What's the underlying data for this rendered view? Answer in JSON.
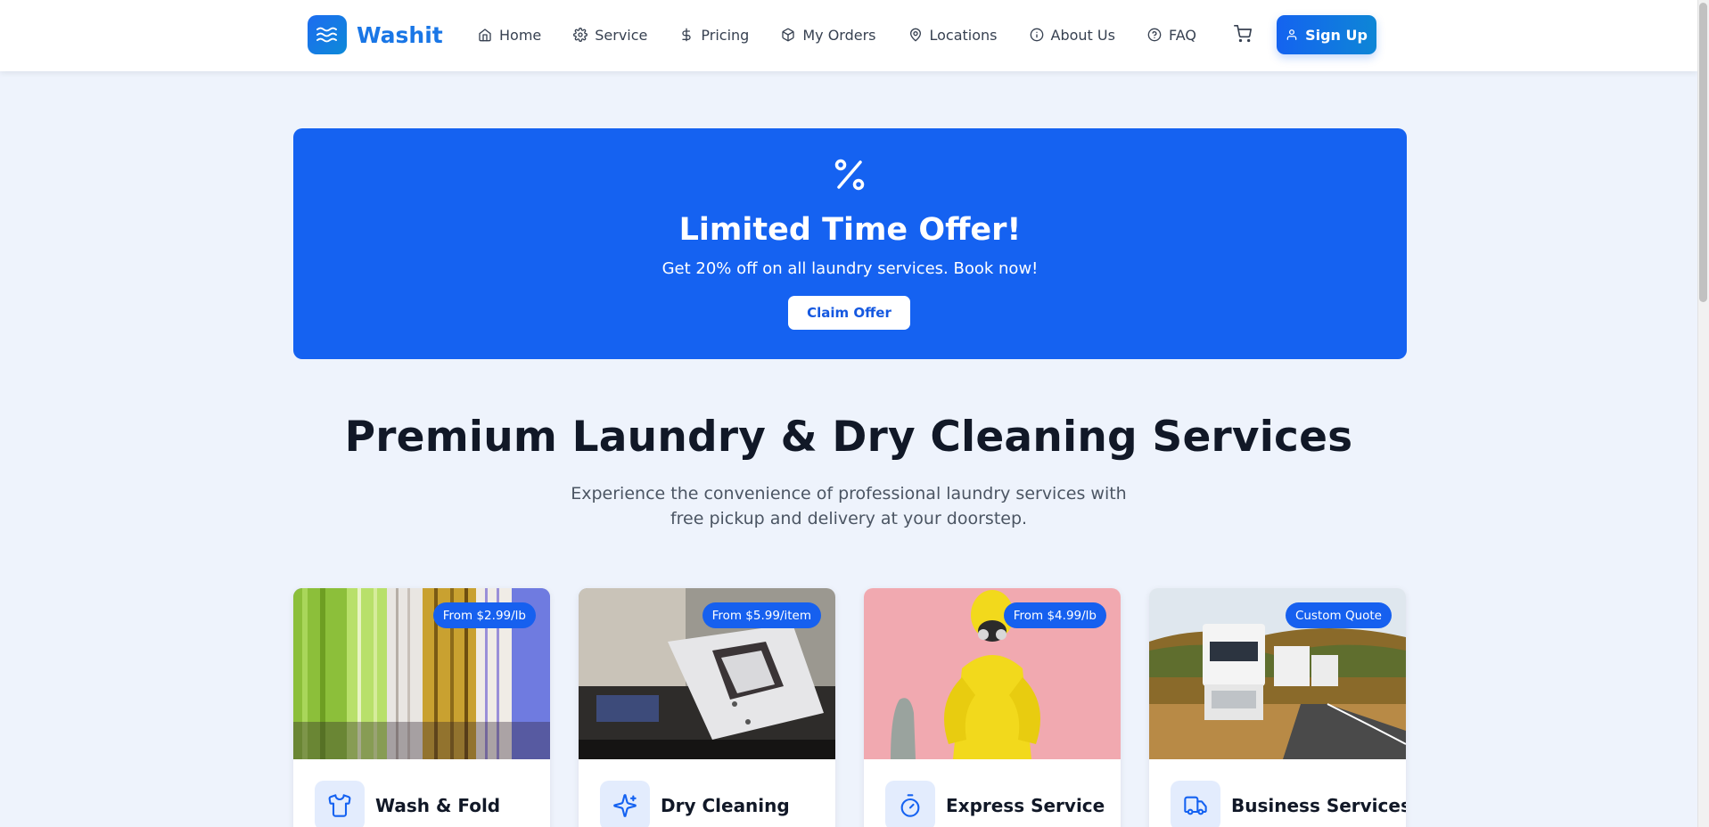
{
  "header": {
    "logo_text": "Washit",
    "nav": [
      {
        "label": "Home",
        "icon": "home-icon"
      },
      {
        "label": "Service",
        "icon": "gear-icon"
      },
      {
        "label": "Pricing",
        "icon": "dollar-icon"
      },
      {
        "label": "My Orders",
        "icon": "package-icon"
      },
      {
        "label": "Locations",
        "icon": "map-pin-icon"
      },
      {
        "label": "About Us",
        "icon": "info-icon"
      },
      {
        "label": "FAQ",
        "icon": "help-circle-icon"
      }
    ],
    "cart_icon": "shopping-cart-icon",
    "signup_label": "Sign Up",
    "signup_icon": "user-icon"
  },
  "promo": {
    "icon": "percent-icon",
    "title": "Limited Time Offer!",
    "subtitle": "Get 20% off on all laundry services. Book now!",
    "button_label": "Claim Offer"
  },
  "hero": {
    "title": "Premium Laundry & Dry Cleaning Services",
    "subtitle": "Experience the convenience of professional laundry services with free pickup and delivery at your doorstep."
  },
  "services": [
    {
      "title": "Wash & Fold",
      "badge": "From $2.99/lb",
      "icon": "shirt-icon",
      "image": "hanging-shirts-photo"
    },
    {
      "title": "Dry Cleaning",
      "badge": "From $5.99/item",
      "icon": "sparkles-icon",
      "image": "folded-shirt-photo"
    },
    {
      "title": "Express Service",
      "badge": "From $4.99/lb",
      "icon": "timer-icon",
      "image": "yellow-suit-photo"
    },
    {
      "title": "Business Services",
      "badge": "Custom Quote",
      "icon": "truck-icon",
      "image": "delivery-trucks-photo"
    }
  ],
  "colors": {
    "brand": "#1976e6",
    "primary": "#1562f1",
    "background": "#eef3fc",
    "heading": "#111827"
  }
}
